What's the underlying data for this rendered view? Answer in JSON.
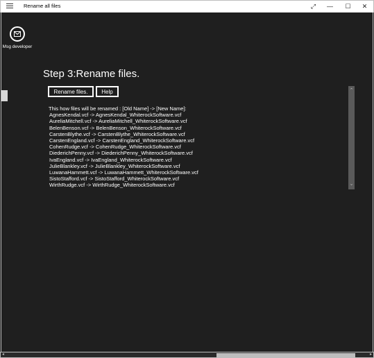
{
  "titlebar": {
    "title": "Rename all files",
    "restore_glyph": "⤢",
    "minimize_glyph": "—",
    "maximize_glyph": "☐",
    "close_glyph": "✕"
  },
  "sidebar": {
    "msg_label": "Msg developer"
  },
  "main": {
    "heading": "Step 3:Rename files.",
    "rename_button": "Rename files.",
    "help_button": "Help",
    "list_header": "This how files will be renamed : [Old Name] -> [New Name]:",
    "rows": [
      "AgnesKendal.vcf -> AgnesKendal_WhiterockSoftware.vcf",
      "AureliaMitchell.vcf -> AureliaMitchell_WhiterockSoftware.vcf",
      "BelenBenson.vcf -> BelenBenson_WhiterockSoftware.vcf",
      "CarstenBlythe.vcf -> CarstenBlythe_WhiterockSoftware.vcf",
      "CarstenEngland.vcf -> CarstenEngland_WhiterockSoftware.vcf",
      "CohenRudge.vcf -> CohenRudge_WhiterockSoftware.vcf",
      "DiederichPenny.vcf -> DiederichPenny_WhiterockSoftware.vcf",
      "IvaEngland.vcf -> IvaEngland_WhiterockSoftware.vcf",
      "JulieBlankley.vcf -> JulieBlankley_WhiterockSoftware.vcf",
      "LuwanaHammett.vcf -> LuwanaHammett_WhiterockSoftware.vcf",
      "SistoStafford.vcf -> SistoStafford_WhiterockSoftware.vcf",
      "WirthRudge.vcf -> WirthRudge_WhiterockSoftware.vcf"
    ]
  },
  "scroll": {
    "up": "⌃",
    "down": "⌄",
    "left": "◂",
    "right": "▸"
  }
}
